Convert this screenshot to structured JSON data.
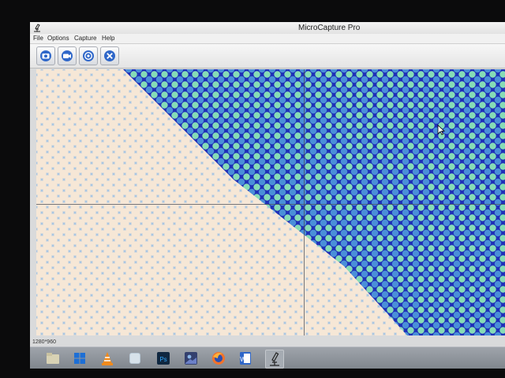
{
  "window": {
    "title": "MicroCapture Pro",
    "app_icon": "microscope-icon"
  },
  "menu": {
    "items": [
      {
        "label": "File"
      },
      {
        "label": "Options"
      },
      {
        "label": "Capture"
      },
      {
        "label": "Help"
      }
    ]
  },
  "toolbar": {
    "buttons": [
      {
        "icon": "snapshot-icon"
      },
      {
        "icon": "record-video-icon"
      },
      {
        "icon": "preview-icon"
      },
      {
        "icon": "close-icon"
      }
    ]
  },
  "status": {
    "resolution": "1280*960"
  },
  "taskbar": {
    "icons": [
      "file-explorer-icon",
      "windows-icon",
      "vlc-icon",
      "finder-icon",
      "photoshop-icon",
      "image-viewer-icon",
      "firefox-icon",
      "word-icon",
      "microscope-icon"
    ]
  },
  "colors": {
    "sample_light": "#f4e6d6",
    "sample_blue_bg": "#2b3fd0",
    "sample_dot_teal": "#7fd6b2",
    "taskbar": "#8c9198"
  }
}
